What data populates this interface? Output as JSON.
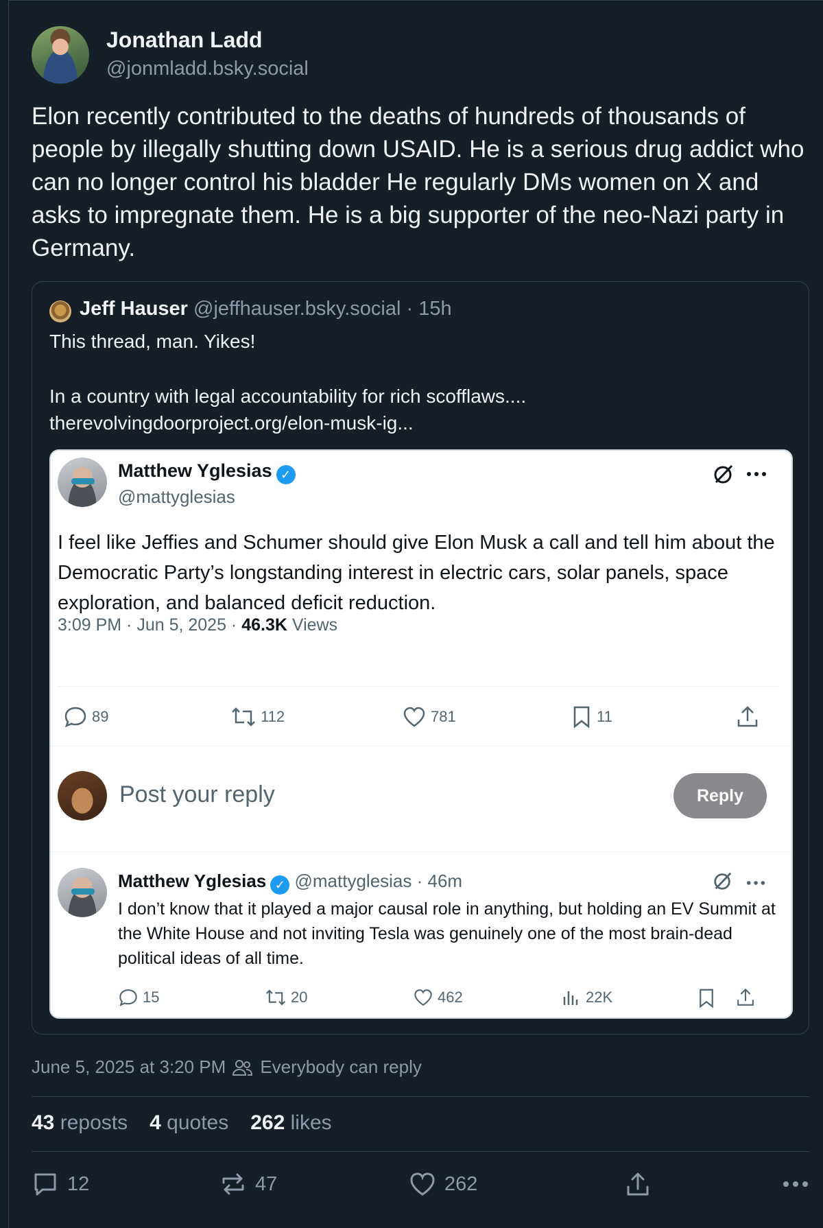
{
  "post": {
    "author_name": "Jonathan Ladd",
    "author_handle": "@jonmladd.bsky.social",
    "text": "Elon recently contributed to the deaths of hundreds of thousands of people by illegally shutting down USAID. He is a serious drug addict who can no longer control his bladder He regularly DMs women on X and asks to impregnate them. He is a big supporter of the neo-Nazi party in Germany.",
    "timestamp": "June 5, 2025 at 3:20 PM",
    "reply_setting": "Everybody can reply",
    "stats": {
      "reposts_count": "43",
      "reposts_label": "reposts",
      "quotes_count": "4",
      "quotes_label": "quotes",
      "likes_count": "262",
      "likes_label": "likes"
    },
    "actions": {
      "replies": "12",
      "reposts": "47",
      "likes": "262"
    }
  },
  "quote": {
    "author_name": "Jeff Hauser",
    "meta": "@jeffhauser.bsky.social · 15h",
    "line1": "This thread, man. Yikes!",
    "line2": "In a country with legal accountability for rich scofflaws....",
    "line3": "therevolvingdoorproject.org/elon-musk-ig..."
  },
  "embedded_tweet": {
    "author_name": "Matthew Yglesias",
    "author_handle": "@mattyglesias",
    "verified_mark": "✓",
    "body": "I feel like Jeffies and Schumer should give Elon Musk a call and tell him about the Democratic Party’s longstanding interest in electric cars, solar panels, space exploration, and balanced deficit reduction.",
    "meta_prefix": "3:09 PM · Jun 5, 2025 · ",
    "views_count": "46.3K",
    "views_label": " Views",
    "replies": "89",
    "retweets": "112",
    "likes": "781",
    "bookmarks": "11",
    "reply_placeholder": "Post your reply",
    "reply_button": "Reply",
    "reply": {
      "author_name": "Matthew Yglesias",
      "meta": "@mattyglesias · 46m",
      "body": "I don’t know that it played a major causal role in anything, but holding an EV Summit at the White House and not inviting Tesla was genuinely one of the most brain-dead political ideas of all time.",
      "replies": "15",
      "retweets": "20",
      "likes": "462",
      "views": "22K"
    }
  },
  "colors": {
    "background": "#161e27",
    "border": "#2e4052",
    "muted_text": "#8d9aa8",
    "verified_blue": "#1d9bf0"
  }
}
